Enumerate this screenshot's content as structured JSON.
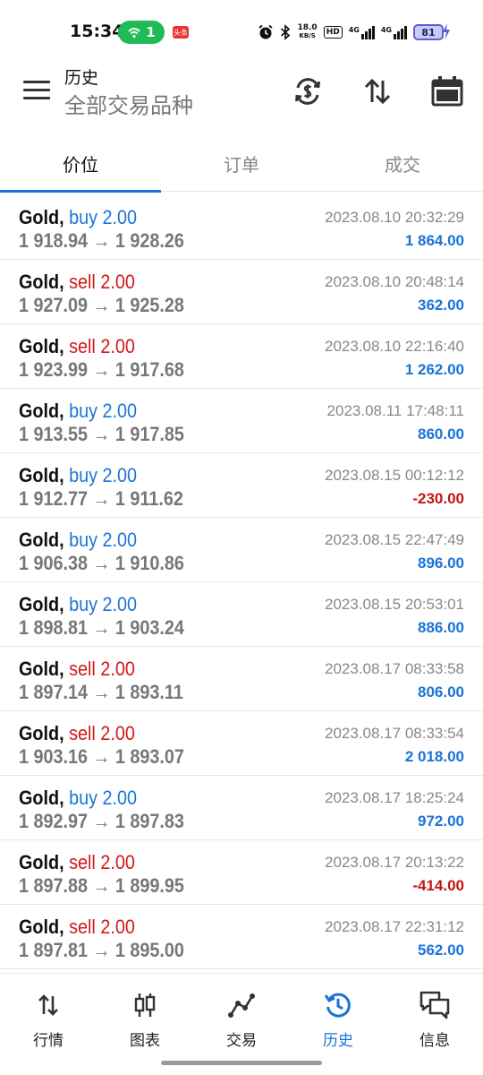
{
  "status_bar": {
    "time": "15:34",
    "hotspot_count": "1",
    "badge_text": "头条",
    "net_speed_value": "18.0",
    "net_speed_unit": "KB/S",
    "hd_label": "HD",
    "sim1_label": "4G",
    "sim2_label": "4G",
    "battery": "81"
  },
  "header": {
    "title": "历史",
    "subtitle": "全部交易品种",
    "icons": [
      "currency-exchange-icon",
      "sort-icon",
      "calendar-icon"
    ]
  },
  "tabs": [
    {
      "label": "价位",
      "active": true
    },
    {
      "label": "订单",
      "active": false
    },
    {
      "label": "成交",
      "active": false
    }
  ],
  "trades": [
    {
      "symbol": "Gold,",
      "side": "buy",
      "action": "buy 2.00",
      "prices": "1 918.94 → 1 928.26",
      "time": "2023.08.10 20:32:29",
      "profit": "1 864.00"
    },
    {
      "symbol": "Gold,",
      "side": "sell",
      "action": "sell 2.00",
      "prices": "1 927.09 → 1 925.28",
      "time": "2023.08.10 20:48:14",
      "profit": "362.00"
    },
    {
      "symbol": "Gold,",
      "side": "sell",
      "action": "sell 2.00",
      "prices": "1 923.99 → 1 917.68",
      "time": "2023.08.10 22:16:40",
      "profit": "1 262.00"
    },
    {
      "symbol": "Gold,",
      "side": "buy",
      "action": "buy 2.00",
      "prices": "1 913.55 → 1 917.85",
      "time": "2023.08.11 17:48:11",
      "profit": "860.00"
    },
    {
      "symbol": "Gold,",
      "side": "buy",
      "action": "buy 2.00",
      "prices": "1 912.77 → 1 911.62",
      "time": "2023.08.15 00:12:12",
      "profit": "-230.00"
    },
    {
      "symbol": "Gold,",
      "side": "buy",
      "action": "buy 2.00",
      "prices": "1 906.38 → 1 910.86",
      "time": "2023.08.15 22:47:49",
      "profit": "896.00"
    },
    {
      "symbol": "Gold,",
      "side": "buy",
      "action": "buy 2.00",
      "prices": "1 898.81 → 1 903.24",
      "time": "2023.08.15 20:53:01",
      "profit": "886.00"
    },
    {
      "symbol": "Gold,",
      "side": "sell",
      "action": "sell 2.00",
      "prices": "1 897.14 → 1 893.11",
      "time": "2023.08.17 08:33:58",
      "profit": "806.00"
    },
    {
      "symbol": "Gold,",
      "side": "sell",
      "action": "sell 2.00",
      "prices": "1 903.16 → 1 893.07",
      "time": "2023.08.17 08:33:54",
      "profit": "2 018.00"
    },
    {
      "symbol": "Gold,",
      "side": "buy",
      "action": "buy 2.00",
      "prices": "1 892.97 → 1 897.83",
      "time": "2023.08.17 18:25:24",
      "profit": "972.00"
    },
    {
      "symbol": "Gold,",
      "side": "sell",
      "action": "sell 2.00",
      "prices": "1 897.88 → 1 899.95",
      "time": "2023.08.17 20:13:22",
      "profit": "-414.00"
    },
    {
      "symbol": "Gold,",
      "side": "sell",
      "action": "sell 2.00",
      "prices": "1 897.81 → 1 895.00",
      "time": "2023.08.17 22:31:12",
      "profit": "562.00"
    }
  ],
  "bottom_nav": [
    {
      "label": "行情",
      "icon": "quotes-arrows-icon",
      "active": false
    },
    {
      "label": "图表",
      "icon": "candlestick-chart-icon",
      "active": false
    },
    {
      "label": "交易",
      "icon": "trade-line-icon",
      "active": false
    },
    {
      "label": "历史",
      "icon": "history-clock-icon",
      "active": true
    },
    {
      "label": "信息",
      "icon": "messages-icon",
      "active": false
    }
  ],
  "colors": {
    "accent": "#1a74d8",
    "sell": "#d01818",
    "loss": "#c41414",
    "muted": "#777777",
    "hotspot": "#1fbb55"
  }
}
